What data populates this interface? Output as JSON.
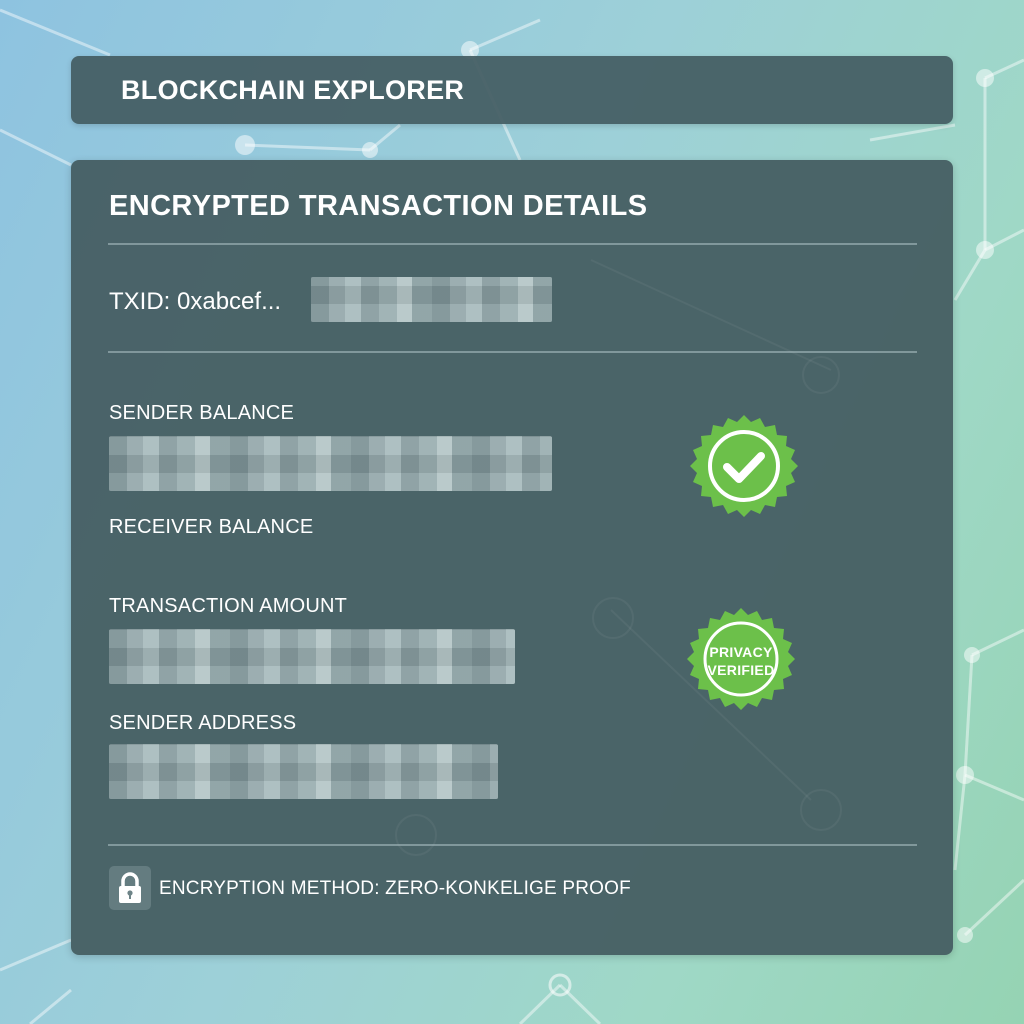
{
  "header": {
    "app_title": "BLOCKCHAIN EXPLORER"
  },
  "panel": {
    "title": "ENCRYPTED TRANSACTION DETAILS",
    "txid_label": "TXID: 0xabcef..."
  },
  "fields": {
    "sender_balance_label": "SENDER BALANCE",
    "receiver_balance_label": "RECEIVER BALANCE",
    "transaction_amount_label": "TRANSACTION AMOUNT",
    "sender_address_label": "SENDER ADDRESS"
  },
  "badges": {
    "verified_icon": "checkmark-icon",
    "privacy_line1": "PRIVACY",
    "privacy_line2": "VERIFIED",
    "color": "#6cc04a"
  },
  "footer": {
    "lock_icon": "lock-icon",
    "encryption_text": "ENCRYPTION METHOD: ZERO-KONKELIGE PROOF"
  },
  "colors": {
    "panel_bg": "#465e62",
    "accent_green": "#6cc04a",
    "text": "#ffffff"
  }
}
